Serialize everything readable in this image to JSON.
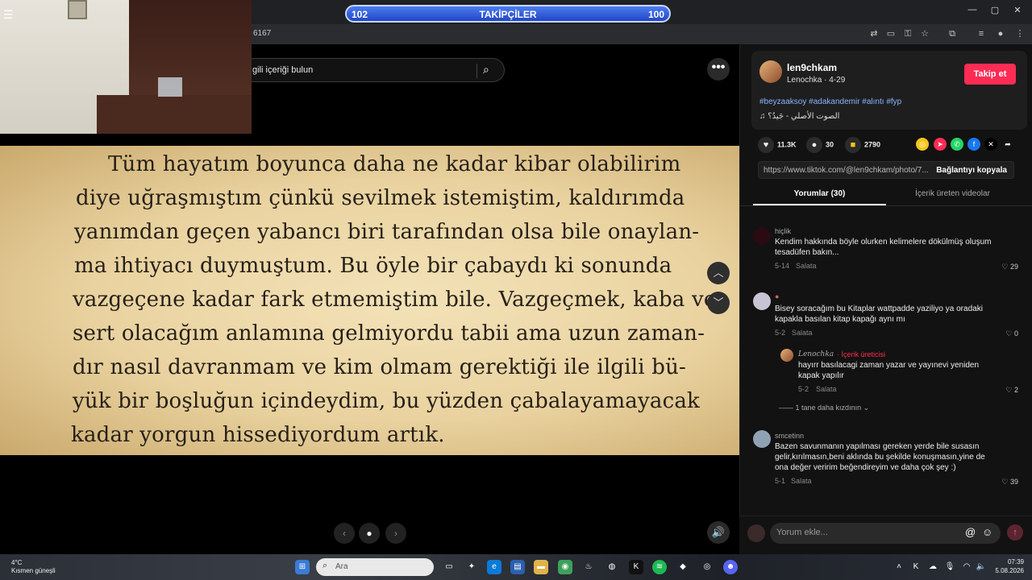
{
  "overlay": {
    "follower_left": "102",
    "follower_label": "TAKİPÇİLER",
    "follower_right": "100"
  },
  "browser": {
    "url_fragment": "6167",
    "window_min": "—",
    "window_max": "▢",
    "window_close": "✕"
  },
  "search": {
    "placeholder": "gili içeriği bulun"
  },
  "book_text": [
    "Tüm hayatım boyunca daha ne kadar kibar olabilirim",
    "diye uğraşmıştım çünkü sevilmek istemiştim, kaldırımda",
    "yanımdan geçen yabancı biri tarafından olsa bile onaylan-",
    "ma ihtiyacı duymuştum. Bu öyle bir çabaydı ki sonunda",
    "vazgeçene kadar fark etmemiştim bile. Vazgeçmek, kaba ve",
    "sert olacağım anlamına gelmiyordu tabii ama uzun zaman-",
    "dır nasıl davranmam ve kim olmam gerektiği ile ilgili bü-",
    "yük bir boşluğun içindeydim, bu yüzden çabalayamayacak",
    "kadar yorgun hissediyordum artık."
  ],
  "author": {
    "username": "len9chkam",
    "display": "Lenochka · 4-29",
    "follow": "Takip et",
    "tags": "#beyzaaksoy #adakandemir #alıntı #fyp",
    "music": "♫ الصوت الأصلي - جَيدُ؟"
  },
  "stats": {
    "likes": "11.3K",
    "comments": "30",
    "saves": "2790"
  },
  "link": {
    "url": "https://www.tiktok.com/@len9chkam/photo/7...",
    "copy": "Bağlantıyı kopyala"
  },
  "tabs": [
    {
      "label": "Yorumlar (30)"
    },
    {
      "label": "İçerik üreten videolar"
    }
  ],
  "comments": [
    {
      "user": "hiçlik",
      "text": "Kendim hakkında böyle olurken kelimelere dökülmüş oluşum tesadüfen bakın...",
      "date": "5-14",
      "reply": "Salata",
      "likes": "29"
    },
    {
      "user": "",
      "text": "Bisey soracağım bu Kitaplar wattpadde yaziliyo ya oradaki kapakla basılan kitap kapağı aynı mı",
      "date": "5-2",
      "reply": "Salata",
      "likes": "0"
    },
    {
      "user": "Lenochka",
      "badge": "· İçerik üreticisi",
      "text": "hayırr basılacagi zaman yazar ve yayınevi yeniden kapak yapılır",
      "date": "5-2",
      "reply": "Salata",
      "likes": "2"
    },
    {
      "user": "smcetinn",
      "text": "Bazen savunmanın yapılması gereken yerde bile susasın gelir,kırılmasın,beni aklında bu şekilde konuşmasın,yine de ona değer veririm beğendireyim ve daha çok şey :)",
      "date": "5-1",
      "reply": "Salata",
      "likes": "39"
    }
  ],
  "more_replies": "1 tane daha kızdının",
  "comment_input": {
    "placeholder": "Yorum ekle..."
  },
  "taskbar": {
    "search_placeholder": "Ara",
    "weather_temp": "4°C",
    "weather_desc": "Kısmen güneşli",
    "time": "07:39",
    "date": "5.08.2026"
  }
}
